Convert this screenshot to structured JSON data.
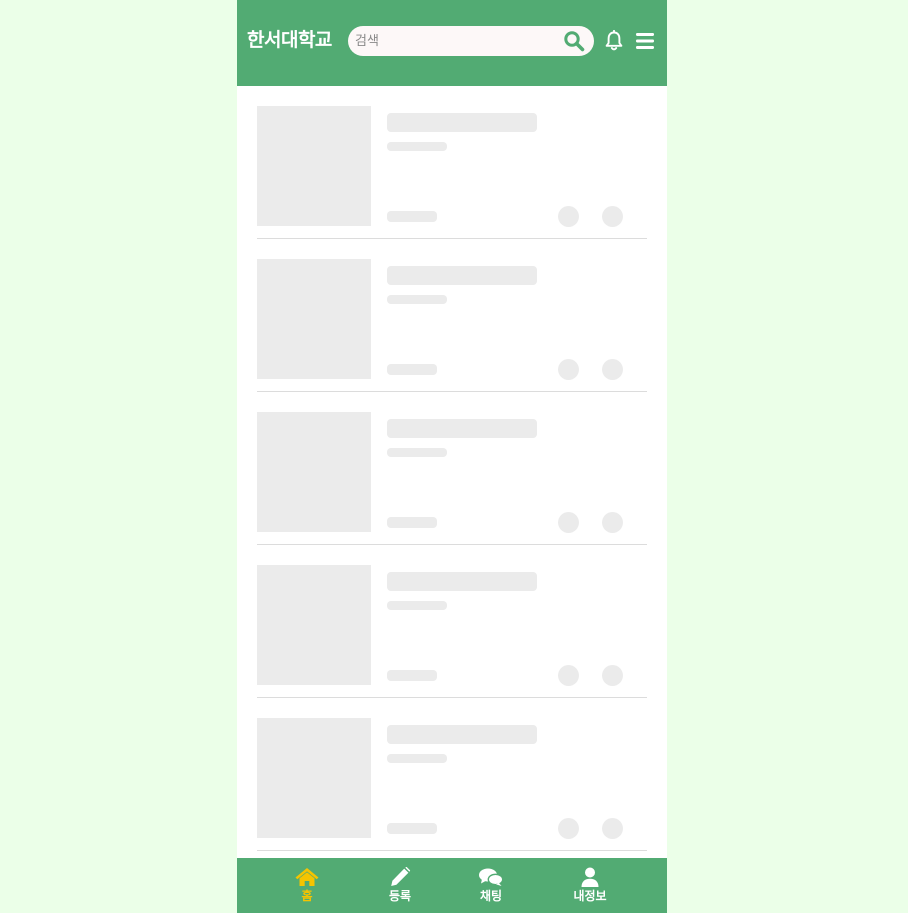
{
  "header": {
    "title": "한서대학교",
    "search": {
      "value": "",
      "placeholder": "검색"
    },
    "icons": {
      "search": "search-icon",
      "notifications": "bell-icon",
      "menu": "hamburger-menu-icon"
    }
  },
  "list": {
    "state": "loading-skeleton",
    "items": [
      {
        "id": 1
      },
      {
        "id": 2
      },
      {
        "id": 3
      },
      {
        "id": 4
      },
      {
        "id": 5
      }
    ]
  },
  "bottom_nav": {
    "items": [
      {
        "label": "홈",
        "icon": "home-icon",
        "active": true
      },
      {
        "label": "등록",
        "icon": "pencil-icon",
        "active": false
      },
      {
        "label": "채팅",
        "icon": "chat-bubbles-icon",
        "active": false
      },
      {
        "label": "내정보",
        "icon": "user-icon",
        "active": false
      }
    ]
  },
  "colors": {
    "page_background": "#ebffe8",
    "header_green": "#52ab73",
    "active_nav": "#f5c400",
    "skeleton": "#ebebeb"
  }
}
